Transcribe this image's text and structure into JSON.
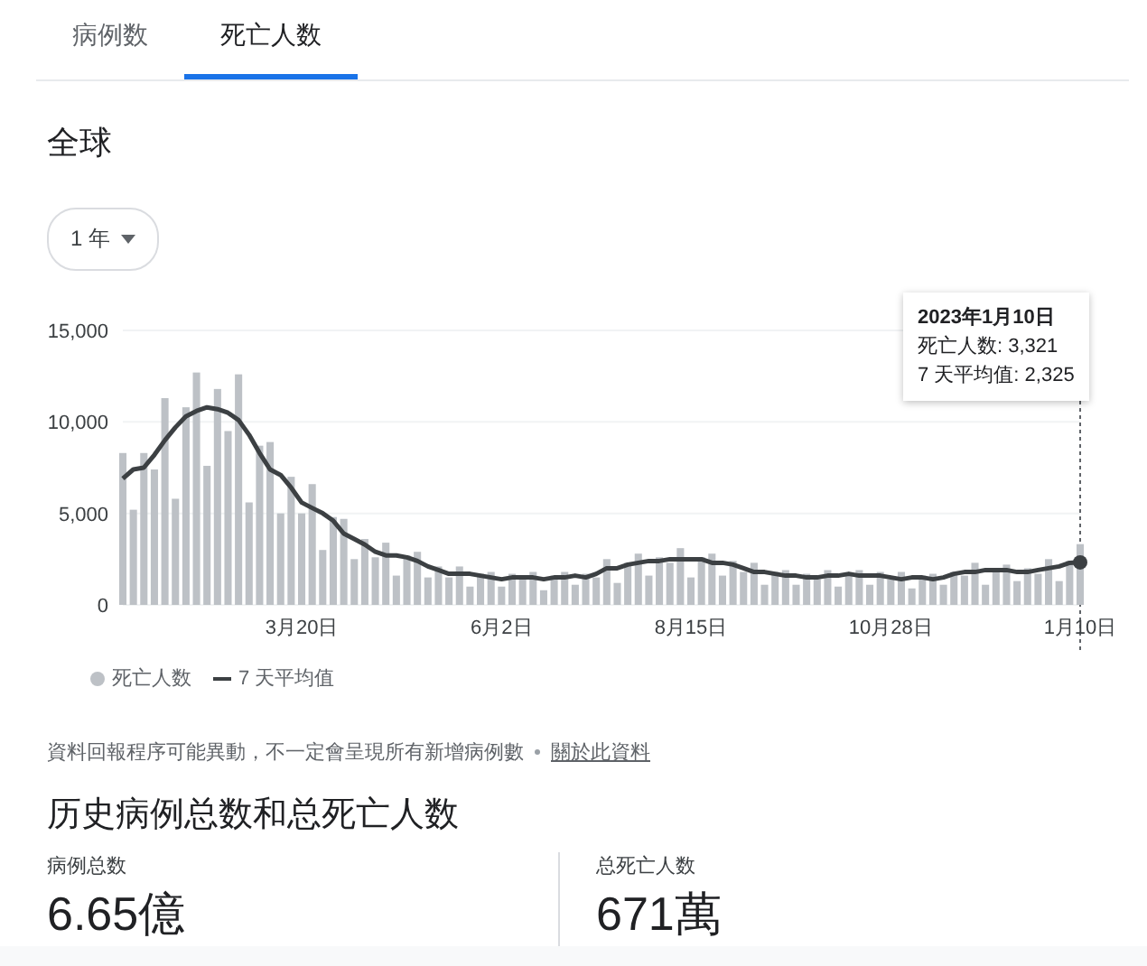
{
  "tabs": [
    {
      "label": "病例数",
      "selected": false
    },
    {
      "label": "死亡人数",
      "selected": true
    }
  ],
  "region_title": "全球",
  "range_dropdown": {
    "value": "1 年"
  },
  "chart": {
    "chart_data": {
      "type": "bar",
      "categories": [
        null,
        null,
        null,
        null,
        null,
        null,
        null,
        null,
        null,
        null,
        null,
        null,
        null,
        null,
        null,
        null,
        null,
        "3月20日",
        null,
        null,
        null,
        null,
        null,
        null,
        null,
        null,
        null,
        null,
        null,
        null,
        null,
        null,
        null,
        null,
        null,
        null,
        "6月2日",
        null,
        null,
        null,
        null,
        null,
        null,
        null,
        null,
        null,
        null,
        null,
        null,
        null,
        null,
        null,
        null,
        null,
        "8月15日",
        null,
        null,
        null,
        null,
        null,
        null,
        null,
        null,
        null,
        null,
        null,
        null,
        null,
        null,
        null,
        null,
        null,
        null,
        "10月28日",
        null,
        null,
        null,
        null,
        null,
        null,
        null,
        null,
        null,
        null,
        null,
        null,
        null,
        null,
        null,
        null,
        null,
        "1月10日"
      ],
      "ylim": [
        0,
        15000
      ],
      "yticks": [
        {
          "value": 0,
          "label": "0"
        },
        {
          "value": 5000,
          "label": "5,000"
        },
        {
          "value": 10000,
          "label": "10,000"
        },
        {
          "value": 15000,
          "label": "15,000"
        }
      ],
      "series": [
        {
          "name": "死亡人数",
          "color": "#bdc1c6",
          "values": [
            8300,
            5200,
            8300,
            7400,
            11300,
            5800,
            10800,
            12700,
            7600,
            11800,
            9500,
            12600,
            5600,
            8700,
            8900,
            5000,
            7000,
            5000,
            6600,
            3000,
            4800,
            4700,
            2500,
            3600,
            2600,
            3400,
            1600,
            2700,
            2900,
            1500,
            2100,
            1500,
            2100,
            1000,
            1700,
            1800,
            1000,
            1700,
            1400,
            1800,
            800,
            1600,
            1800,
            1100,
            1700,
            1500,
            2500,
            1200,
            2300,
            2800,
            1600,
            2600,
            2300,
            3100,
            1500,
            2600,
            2800,
            1600,
            2400,
            1800,
            2300,
            1100,
            1800,
            1900,
            1100,
            1700,
            1400,
            1900,
            1000,
            1700,
            1900,
            1100,
            1800,
            1400,
            1800,
            900,
            1600,
            1700,
            1100,
            1800,
            1600,
            2300,
            1100,
            2000,
            2200,
            1300,
            2000,
            1700,
            2500,
            1300,
            2400,
            3321
          ]
        },
        {
          "name": "7 天平均值",
          "type": "line",
          "color": "#3c4043",
          "values": [
            6900,
            7400,
            7500,
            8200,
            9000,
            9700,
            10300,
            10600,
            10800,
            10700,
            10500,
            10100,
            9300,
            8300,
            7400,
            7100,
            6400,
            5600,
            5300,
            5000,
            4600,
            3900,
            3600,
            3300,
            2900,
            2700,
            2700,
            2600,
            2400,
            2100,
            1900,
            1700,
            1700,
            1700,
            1600,
            1500,
            1400,
            1500,
            1500,
            1500,
            1400,
            1500,
            1500,
            1600,
            1500,
            1700,
            2000,
            2000,
            2200,
            2300,
            2400,
            2400,
            2500,
            2500,
            2500,
            2500,
            2300,
            2300,
            2200,
            2000,
            1800,
            1800,
            1700,
            1600,
            1600,
            1500,
            1500,
            1600,
            1600,
            1700,
            1600,
            1600,
            1600,
            1500,
            1400,
            1500,
            1500,
            1400,
            1500,
            1700,
            1800,
            1800,
            1900,
            1900,
            1900,
            1800,
            1800,
            1900,
            2000,
            2100,
            2300,
            2325
          ]
        }
      ]
    },
    "tooltip": {
      "date": "2023年1月10日",
      "lines": [
        "死亡人数: 3,321",
        "7 天平均值: 2,325"
      ]
    }
  },
  "note": {
    "text": "資料回報程序可能異動，不一定會呈現所有新增病例數",
    "link": "關於此資料"
  },
  "totals": {
    "title": "历史病例总数和总死亡人数",
    "stats": [
      {
        "label": "病例总数",
        "value": "6.65億"
      },
      {
        "label": "总死亡人数",
        "value": "671萬"
      }
    ]
  }
}
